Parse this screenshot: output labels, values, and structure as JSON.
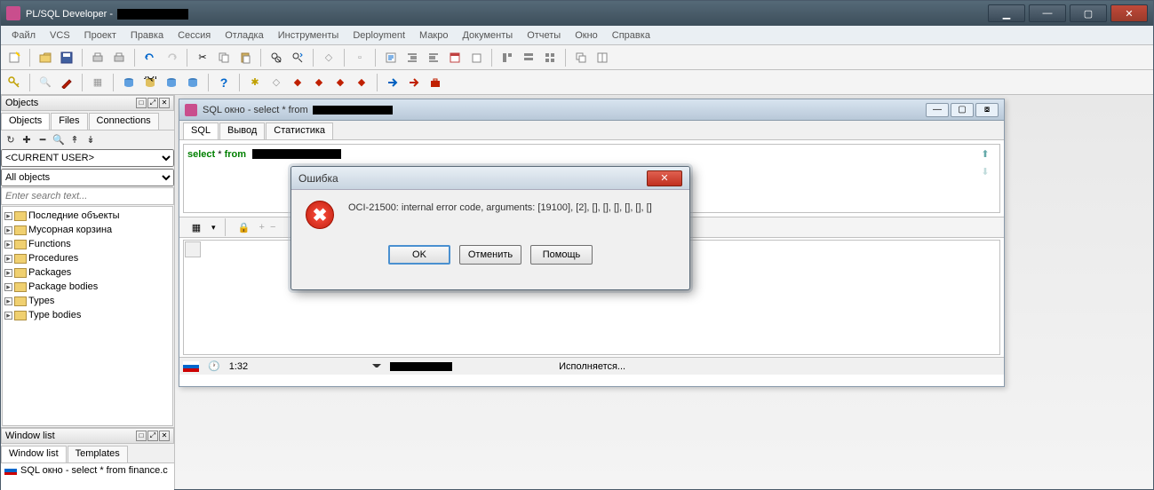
{
  "app": {
    "title": "PL/SQL Developer - "
  },
  "menu": {
    "items": [
      "Файл",
      "VCS",
      "Проект",
      "Правка",
      "Сессия",
      "Отладка",
      "Инструменты",
      "Deployment",
      "Макро",
      "Документы",
      "Отчеты",
      "Окно",
      "Справка"
    ]
  },
  "sidebar": {
    "objects_header": "Objects",
    "tabs": [
      "Objects",
      "Files",
      "Connections"
    ],
    "user_dropdown": "<CURRENT USER>",
    "filter_dropdown": "All objects",
    "search_placeholder": "Enter search text...",
    "tree": [
      "Последние объекты",
      "Мусорная корзина",
      "Functions",
      "Procedures",
      "Packages",
      "Package bodies",
      "Types",
      "Type bodies"
    ],
    "window_list_header": "Window list",
    "window_list_tabs": [
      "Window list",
      "Templates"
    ],
    "window_list_item": "SQL окно - select * from finance.c"
  },
  "child_window": {
    "title": "SQL окно - select * from ",
    "tabs": [
      "SQL",
      "Вывод",
      "Статистика"
    ],
    "sql_keyword1": "select",
    "sql_star": " * ",
    "sql_keyword2": "from",
    "status_time": "1:32",
    "status_text": "Исполняется..."
  },
  "dialog": {
    "title": "Ошибка",
    "message": "OCI-21500: internal error code, arguments: [19100], [2], [], [], [], [], [], []",
    "buttons": {
      "ok": "OK",
      "cancel": "Отменить",
      "help": "Помощь"
    }
  }
}
